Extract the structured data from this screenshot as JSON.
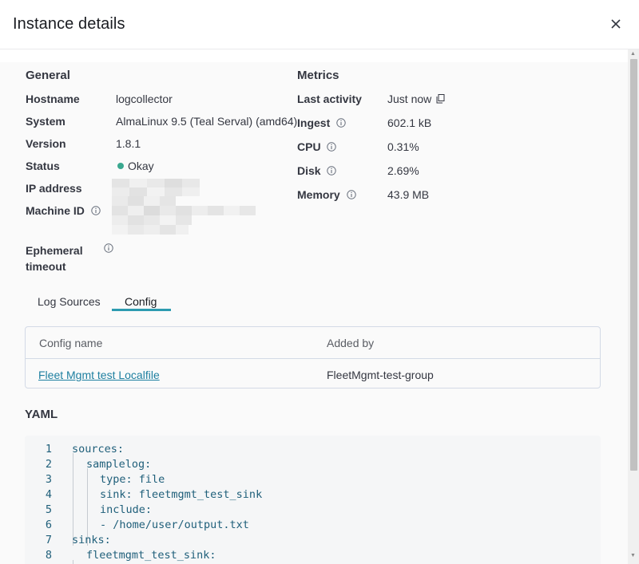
{
  "dialog": {
    "title": "Instance details",
    "close_icon": "close-icon"
  },
  "general": {
    "title": "General",
    "hostname_label": "Hostname",
    "hostname_value": "logcollector",
    "system_label": "System",
    "system_value": "AlmaLinux 9.5 (Teal Serval) (amd64)",
    "version_label": "Version",
    "version_value": "1.8.1",
    "status_label": "Status",
    "status_value": "Okay",
    "status_color": "#3aa88f",
    "ip_label": "IP address",
    "machine_id_label": "Machine ID",
    "ephemeral_label_line1": "Ephemeral",
    "ephemeral_label_line2": "timeout"
  },
  "metrics": {
    "title": "Metrics",
    "last_activity_label": "Last activity",
    "last_activity_value": "Just now",
    "ingest_label": "Ingest",
    "ingest_value": "602.1 kB",
    "cpu_label": "CPU",
    "cpu_value": "0.31%",
    "disk_label": "Disk",
    "disk_value": "2.69%",
    "memory_label": "Memory",
    "memory_value": "43.9 MB"
  },
  "tabs": [
    {
      "label": "Log Sources",
      "active": false
    },
    {
      "label": "Config",
      "active": true
    }
  ],
  "config_table": {
    "columns": [
      "Config name",
      "Added by"
    ],
    "rows": [
      {
        "config_name": "Fleet Mgmt test Localfile",
        "added_by": "FleetMgmt-test-group"
      }
    ]
  },
  "yaml": {
    "title": "YAML",
    "lines": [
      {
        "n": "1",
        "text": "sources:"
      },
      {
        "n": "2",
        "text": "samplelog:"
      },
      {
        "n": "3",
        "text": "type: file"
      },
      {
        "n": "4",
        "text": "sink: fleetmgmt_test_sink"
      },
      {
        "n": "5",
        "text": "include:"
      },
      {
        "n": "6",
        "text": "- /home/user/output.txt"
      },
      {
        "n": "7",
        "text": "sinks:"
      },
      {
        "n": "8",
        "text": "fleetmgmt_test_sink:"
      }
    ]
  },
  "colors": {
    "accent": "#2d9bb0",
    "link": "#1d7fa0"
  }
}
